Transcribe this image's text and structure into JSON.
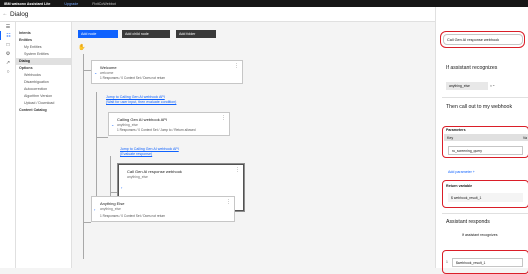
{
  "topbar": {
    "brand": "IBM watsonx Assistant Lite",
    "upgrade": "Upgrade",
    "workspace": "FixitCoWebbot"
  },
  "page": {
    "title": "Dialog"
  },
  "nav": {
    "items": [
      {
        "label": "Intents",
        "level": "l1"
      },
      {
        "label": "Entities",
        "level": "l1"
      },
      {
        "label": "My Entities",
        "level": "l2"
      },
      {
        "label": "System Entities",
        "level": "l2"
      },
      {
        "label": "Dialog",
        "level": "l1",
        "active": true
      },
      {
        "label": "Options",
        "level": "l1"
      },
      {
        "label": "Webhooks",
        "level": "l2"
      },
      {
        "label": "Disambiguation",
        "level": "l2"
      },
      {
        "label": "Autocorrection",
        "level": "l2"
      },
      {
        "label": "Algorithm Version",
        "level": "l2"
      },
      {
        "label": "Upload / Download",
        "level": "l2"
      },
      {
        "label": "Content Catalog",
        "level": "l1"
      }
    ]
  },
  "toolbar": {
    "add_node": "Add node",
    "add_child_node": "Add child node",
    "add_folder": "Add folder"
  },
  "nodes": {
    "welcome": {
      "name": "Welcome",
      "condition": "welcome",
      "meta": "1 Responses / 0 Context Set / Does not return"
    },
    "jump1": {
      "text": "Jump to Calling Gen AI webhook API",
      "sub": "(Wait for user input, then evaluate condition)"
    },
    "calling": {
      "name": "Calling Gen AI webhook API",
      "condition": "anything_else",
      "meta": "1 Responses / 0 Context Set / Jump to / Return allowed"
    },
    "jump2": {
      "text": "Jump to Calling Gen AI webhook API",
      "sub": "(Evaluate response)"
    },
    "call": {
      "name": "Call Gen AI response webhook",
      "condition": "anything_else",
      "meta": "3 Responses / 0 Context Set / Return allowed"
    },
    "anything": {
      "name": "Anything Else",
      "condition": "anything_else",
      "meta": "1 Responses / 0 Context Set / Does not return"
    }
  },
  "panel": {
    "node_name": "Call Gen AI response webhook",
    "recognizes_heading": "If assistant recognizes",
    "condition_chip": "anything_else",
    "callout_heading": "Then call out to my webhook",
    "parameters_label": "Parameters",
    "key_col": "Key",
    "value_col": "Va",
    "param_value": "ru_screening_query",
    "add_parameter": "Add parameter +",
    "return_variable_label": "Return variable",
    "return_variable_value": "$ webhook_result_1",
    "responds_heading": "Assistant responds",
    "if_recognizes": "If assistant recognizes",
    "response_index": "1",
    "response_value": "$webhook_result_1"
  },
  "colors": {
    "accent": "#0f62fe",
    "highlight": "#da1e28"
  }
}
